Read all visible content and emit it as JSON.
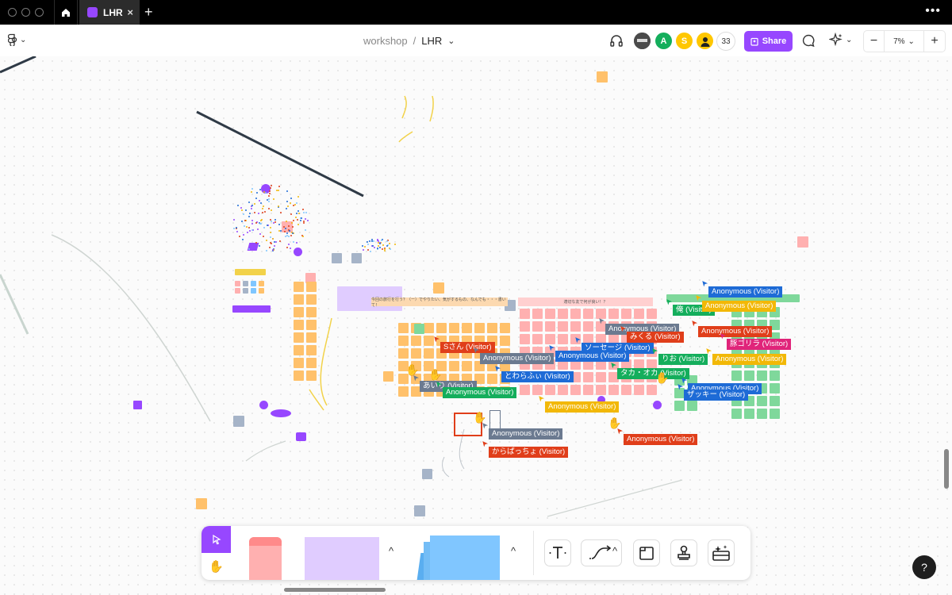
{
  "window": {
    "tab_title": "LHR",
    "tab_close": "×",
    "new_tab": "+",
    "more": "⋮"
  },
  "toolbar": {
    "breadcrumb_project": "workshop",
    "breadcrumb_separator": "/",
    "breadcrumb_file": "LHR",
    "avatars": [
      {
        "initial": "",
        "color": "#6b6b6b",
        "kind": "photo"
      },
      {
        "initial": "A",
        "color": "#14ae5c",
        "kind": "letter"
      },
      {
        "initial": "S",
        "color": "#ffc700",
        "kind": "letter"
      },
      {
        "initial": "",
        "color": "#ffc700",
        "kind": "person"
      }
    ],
    "participant_count": "33",
    "share_label": "Share",
    "zoom_minus": "−",
    "zoom_level": "7%",
    "zoom_plus": "+"
  },
  "canvas": {
    "colors": {
      "orange": "#ffc16b",
      "pink": "#ffb0b0",
      "green": "#7fd89b",
      "purple": "#9747ff",
      "lilac": "#e0ccff",
      "gray": "#a6b4c8",
      "blue": "#1e6bd6",
      "red": "#e03e1a",
      "darkgreen": "#14ae5c"
    },
    "section_headers": [
      "今回の旅行を行う？（ー）でやりたい、気がするもの、なんでも・・・書いて！",
      "適切な友で何が良い！？"
    ],
    "cursor_labels": [
      {
        "text": "Anonymous (Visitor)",
        "color": "#1e6bd6"
      },
      {
        "text": "俺 (Visitor)",
        "color": "#14ae5c"
      },
      {
        "text": "Anonymous (Visitor)",
        "color": "#f2b807"
      },
      {
        "text": "Anonymous (Visitor)",
        "color": "#6b7a90"
      },
      {
        "text": "みくる (Visitor)",
        "color": "#e03e1a"
      },
      {
        "text": "Anonymous (Visitor)",
        "color": "#e03e1a"
      },
      {
        "text": "豚ゴリラ (Visitor)",
        "color": "#e0247a"
      },
      {
        "text": "Sさん (Visitor)",
        "color": "#e03e1a"
      },
      {
        "text": "Anonymous (Visitor)",
        "color": "#6b7a90"
      },
      {
        "text": "ソーセージ (Visitor)",
        "color": "#1e6bd6"
      },
      {
        "text": "Anonymous (Visitor)",
        "color": "#1e6bd6"
      },
      {
        "text": "りお (Visitor)",
        "color": "#14ae5c"
      },
      {
        "text": "Anonymous (Visitor)",
        "color": "#f2b807"
      },
      {
        "text": "とわらふぃ (Visitor)",
        "color": "#1e6bd6"
      },
      {
        "text": "タカ・オカ (Visitor)",
        "color": "#14ae5c"
      },
      {
        "text": "あいり (Visitor)",
        "color": "#6b7a90"
      },
      {
        "text": "Anonymous (Visitor)",
        "color": "#14ae5c"
      },
      {
        "text": "Anonymous (Visitor)",
        "color": "#1e6bd6"
      },
      {
        "text": "ザッキー (Visitor)",
        "color": "#1e6bd6"
      },
      {
        "text": "Anonymous (Visitor)",
        "color": "#f2b807"
      },
      {
        "text": "Anonymous (Visitor)",
        "color": "#6b7a90"
      },
      {
        "text": "からぱっちょ (Visitor)",
        "color": "#e03e1a"
      },
      {
        "text": "Anonymous (Visitor)",
        "color": "#e03e1a"
      }
    ]
  },
  "bottom_toolbar": {
    "caret": "^",
    "tools": [
      "text-tool",
      "connector-tool",
      "section-tool",
      "stamp-tool",
      "widget-tool"
    ]
  },
  "help_label": "?"
}
